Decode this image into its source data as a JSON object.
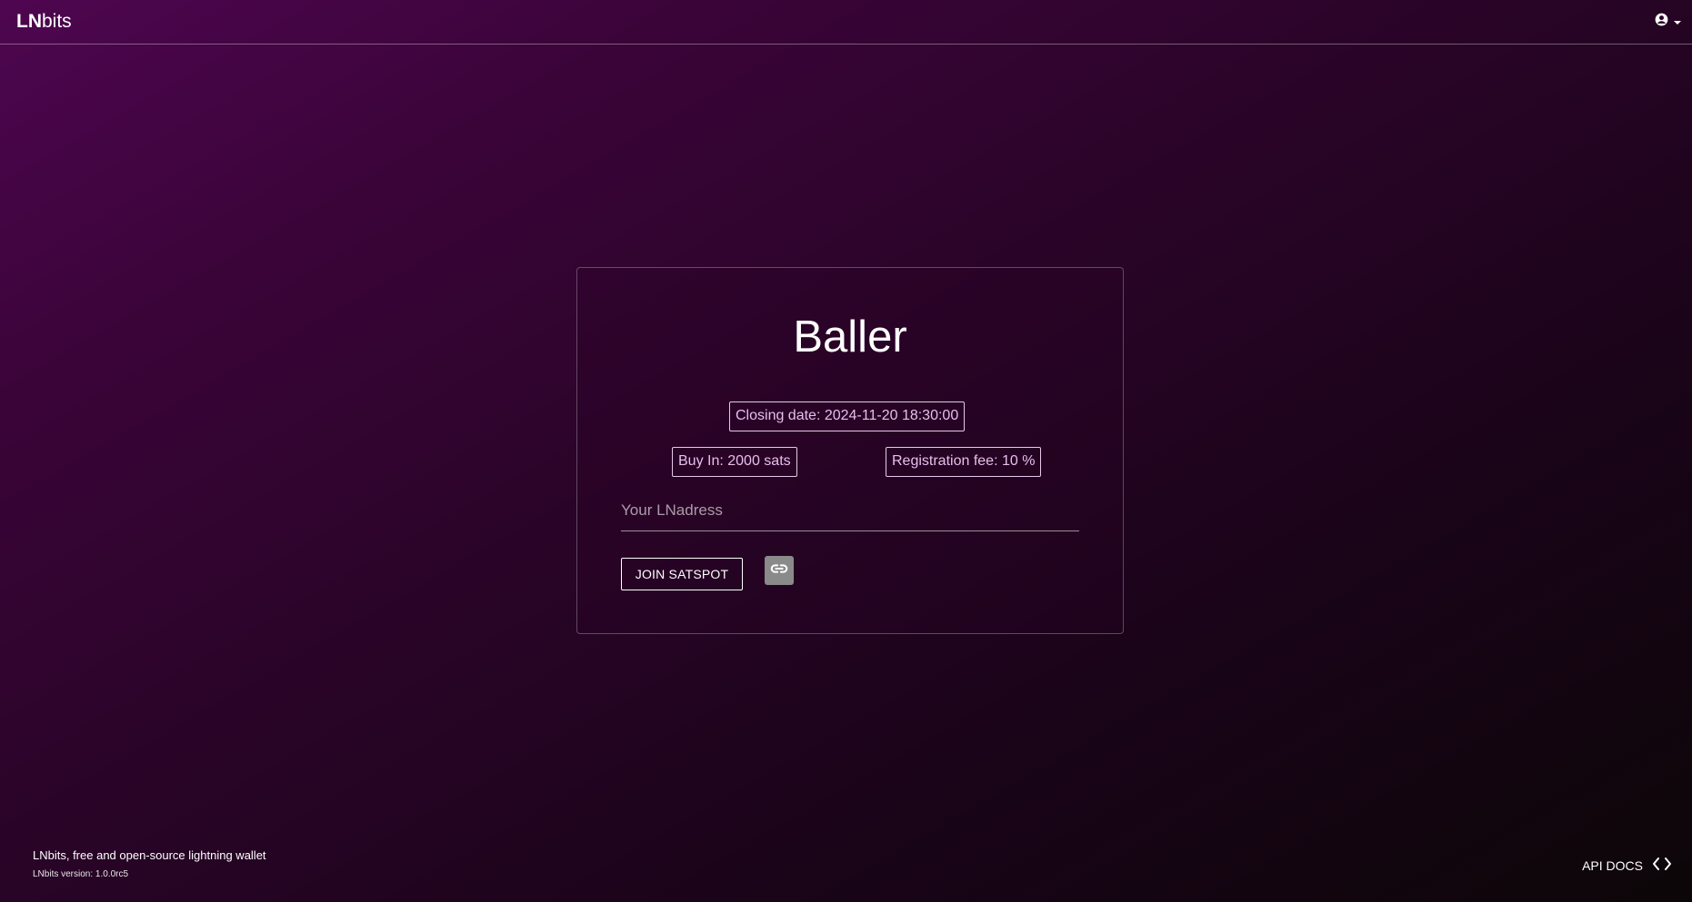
{
  "header": {
    "brand_bold": "LN",
    "brand_rest": "bits"
  },
  "card": {
    "title": "Baller",
    "closing_date": "Closing date: 2024-11-20 18:30:00",
    "buy_in": "Buy In: 2000 sats",
    "registration_fee": "Registration fee: 10 %",
    "lnaddress_placeholder": "Your LNadress",
    "lnaddress_value": "",
    "join_button": "JOIN SATSPOT"
  },
  "footer": {
    "tagline": "LNbits, free and open-source lightning wallet",
    "version": "LNbits version: 1.0.0rc5",
    "api_docs": "API DOCS"
  },
  "icons": {
    "account": "account-circle-icon",
    "dropdown": "caret-down-icon",
    "link": "link-icon",
    "code": "code-icon"
  },
  "colors": {
    "background_top": "#4e0650",
    "background_bottom": "#0c0608",
    "chip_text": "#e8bfee",
    "link_button_bg": "#8a8a8a"
  }
}
